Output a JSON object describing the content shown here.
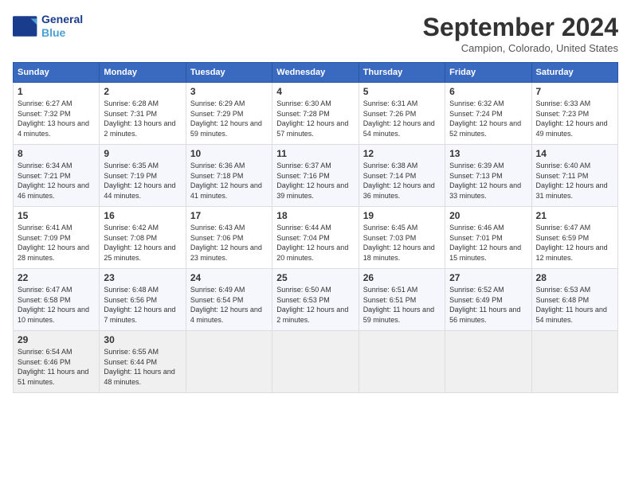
{
  "header": {
    "logo_line1": "General",
    "logo_line2": "Blue",
    "month": "September 2024",
    "location": "Campion, Colorado, United States"
  },
  "weekdays": [
    "Sunday",
    "Monday",
    "Tuesday",
    "Wednesday",
    "Thursday",
    "Friday",
    "Saturday"
  ],
  "weeks": [
    [
      {
        "day": "1",
        "sunrise": "Sunrise: 6:27 AM",
        "sunset": "Sunset: 7:32 PM",
        "daylight": "Daylight: 13 hours and 4 minutes."
      },
      {
        "day": "2",
        "sunrise": "Sunrise: 6:28 AM",
        "sunset": "Sunset: 7:31 PM",
        "daylight": "Daylight: 13 hours and 2 minutes."
      },
      {
        "day": "3",
        "sunrise": "Sunrise: 6:29 AM",
        "sunset": "Sunset: 7:29 PM",
        "daylight": "Daylight: 12 hours and 59 minutes."
      },
      {
        "day": "4",
        "sunrise": "Sunrise: 6:30 AM",
        "sunset": "Sunset: 7:28 PM",
        "daylight": "Daylight: 12 hours and 57 minutes."
      },
      {
        "day": "5",
        "sunrise": "Sunrise: 6:31 AM",
        "sunset": "Sunset: 7:26 PM",
        "daylight": "Daylight: 12 hours and 54 minutes."
      },
      {
        "day": "6",
        "sunrise": "Sunrise: 6:32 AM",
        "sunset": "Sunset: 7:24 PM",
        "daylight": "Daylight: 12 hours and 52 minutes."
      },
      {
        "day": "7",
        "sunrise": "Sunrise: 6:33 AM",
        "sunset": "Sunset: 7:23 PM",
        "daylight": "Daylight: 12 hours and 49 minutes."
      }
    ],
    [
      {
        "day": "8",
        "sunrise": "Sunrise: 6:34 AM",
        "sunset": "Sunset: 7:21 PM",
        "daylight": "Daylight: 12 hours and 46 minutes."
      },
      {
        "day": "9",
        "sunrise": "Sunrise: 6:35 AM",
        "sunset": "Sunset: 7:19 PM",
        "daylight": "Daylight: 12 hours and 44 minutes."
      },
      {
        "day": "10",
        "sunrise": "Sunrise: 6:36 AM",
        "sunset": "Sunset: 7:18 PM",
        "daylight": "Daylight: 12 hours and 41 minutes."
      },
      {
        "day": "11",
        "sunrise": "Sunrise: 6:37 AM",
        "sunset": "Sunset: 7:16 PM",
        "daylight": "Daylight: 12 hours and 39 minutes."
      },
      {
        "day": "12",
        "sunrise": "Sunrise: 6:38 AM",
        "sunset": "Sunset: 7:14 PM",
        "daylight": "Daylight: 12 hours and 36 minutes."
      },
      {
        "day": "13",
        "sunrise": "Sunrise: 6:39 AM",
        "sunset": "Sunset: 7:13 PM",
        "daylight": "Daylight: 12 hours and 33 minutes."
      },
      {
        "day": "14",
        "sunrise": "Sunrise: 6:40 AM",
        "sunset": "Sunset: 7:11 PM",
        "daylight": "Daylight: 12 hours and 31 minutes."
      }
    ],
    [
      {
        "day": "15",
        "sunrise": "Sunrise: 6:41 AM",
        "sunset": "Sunset: 7:09 PM",
        "daylight": "Daylight: 12 hours and 28 minutes."
      },
      {
        "day": "16",
        "sunrise": "Sunrise: 6:42 AM",
        "sunset": "Sunset: 7:08 PM",
        "daylight": "Daylight: 12 hours and 25 minutes."
      },
      {
        "day": "17",
        "sunrise": "Sunrise: 6:43 AM",
        "sunset": "Sunset: 7:06 PM",
        "daylight": "Daylight: 12 hours and 23 minutes."
      },
      {
        "day": "18",
        "sunrise": "Sunrise: 6:44 AM",
        "sunset": "Sunset: 7:04 PM",
        "daylight": "Daylight: 12 hours and 20 minutes."
      },
      {
        "day": "19",
        "sunrise": "Sunrise: 6:45 AM",
        "sunset": "Sunset: 7:03 PM",
        "daylight": "Daylight: 12 hours and 18 minutes."
      },
      {
        "day": "20",
        "sunrise": "Sunrise: 6:46 AM",
        "sunset": "Sunset: 7:01 PM",
        "daylight": "Daylight: 12 hours and 15 minutes."
      },
      {
        "day": "21",
        "sunrise": "Sunrise: 6:47 AM",
        "sunset": "Sunset: 6:59 PM",
        "daylight": "Daylight: 12 hours and 12 minutes."
      }
    ],
    [
      {
        "day": "22",
        "sunrise": "Sunrise: 6:47 AM",
        "sunset": "Sunset: 6:58 PM",
        "daylight": "Daylight: 12 hours and 10 minutes."
      },
      {
        "day": "23",
        "sunrise": "Sunrise: 6:48 AM",
        "sunset": "Sunset: 6:56 PM",
        "daylight": "Daylight: 12 hours and 7 minutes."
      },
      {
        "day": "24",
        "sunrise": "Sunrise: 6:49 AM",
        "sunset": "Sunset: 6:54 PM",
        "daylight": "Daylight: 12 hours and 4 minutes."
      },
      {
        "day": "25",
        "sunrise": "Sunrise: 6:50 AM",
        "sunset": "Sunset: 6:53 PM",
        "daylight": "Daylight: 12 hours and 2 minutes."
      },
      {
        "day": "26",
        "sunrise": "Sunrise: 6:51 AM",
        "sunset": "Sunset: 6:51 PM",
        "daylight": "Daylight: 11 hours and 59 minutes."
      },
      {
        "day": "27",
        "sunrise": "Sunrise: 6:52 AM",
        "sunset": "Sunset: 6:49 PM",
        "daylight": "Daylight: 11 hours and 56 minutes."
      },
      {
        "day": "28",
        "sunrise": "Sunrise: 6:53 AM",
        "sunset": "Sunset: 6:48 PM",
        "daylight": "Daylight: 11 hours and 54 minutes."
      }
    ],
    [
      {
        "day": "29",
        "sunrise": "Sunrise: 6:54 AM",
        "sunset": "Sunset: 6:46 PM",
        "daylight": "Daylight: 11 hours and 51 minutes."
      },
      {
        "day": "30",
        "sunrise": "Sunrise: 6:55 AM",
        "sunset": "Sunset: 6:44 PM",
        "daylight": "Daylight: 11 hours and 48 minutes."
      },
      null,
      null,
      null,
      null,
      null
    ]
  ]
}
